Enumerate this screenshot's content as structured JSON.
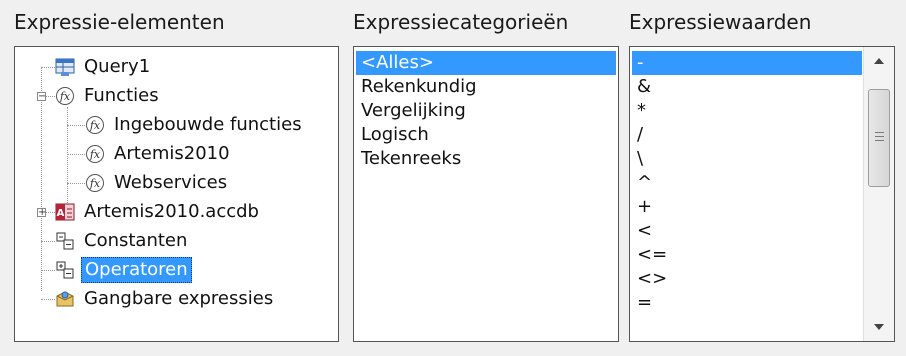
{
  "elements_panel": {
    "title": "Expressie-elementen",
    "items": [
      {
        "label": "Query1",
        "icon": "query-icon"
      },
      {
        "label": "Functies",
        "icon": "function-icon",
        "expander": "−"
      },
      {
        "label": "Ingebouwde functies",
        "icon": "function-icon"
      },
      {
        "label": "Artemis2010",
        "icon": "function-icon"
      },
      {
        "label": "Webservices",
        "icon": "function-icon"
      },
      {
        "label": "Artemis2010.accdb",
        "icon": "access-database-icon",
        "expander": "+"
      },
      {
        "label": "Constanten",
        "icon": "constants-icon"
      },
      {
        "label": "Operatoren",
        "icon": "operators-icon",
        "selected": true
      },
      {
        "label": "Gangbare expressies",
        "icon": "common-expressions-icon"
      }
    ]
  },
  "categories_panel": {
    "title": "Expressiecategorieën",
    "items": [
      "<Alles>",
      "Rekenkundig",
      "Vergelijking",
      "Logisch",
      "Tekenreeks"
    ],
    "selected_index": 0
  },
  "values_panel": {
    "title": "Expressiewaarden",
    "items": [
      "-",
      "&",
      "*",
      "/",
      "\\",
      "^",
      "+",
      "<",
      "<=",
      "<>",
      "="
    ],
    "selected_index": 0
  },
  "colors": {
    "selection": "#3399ff",
    "background": "#f0f0f0"
  }
}
